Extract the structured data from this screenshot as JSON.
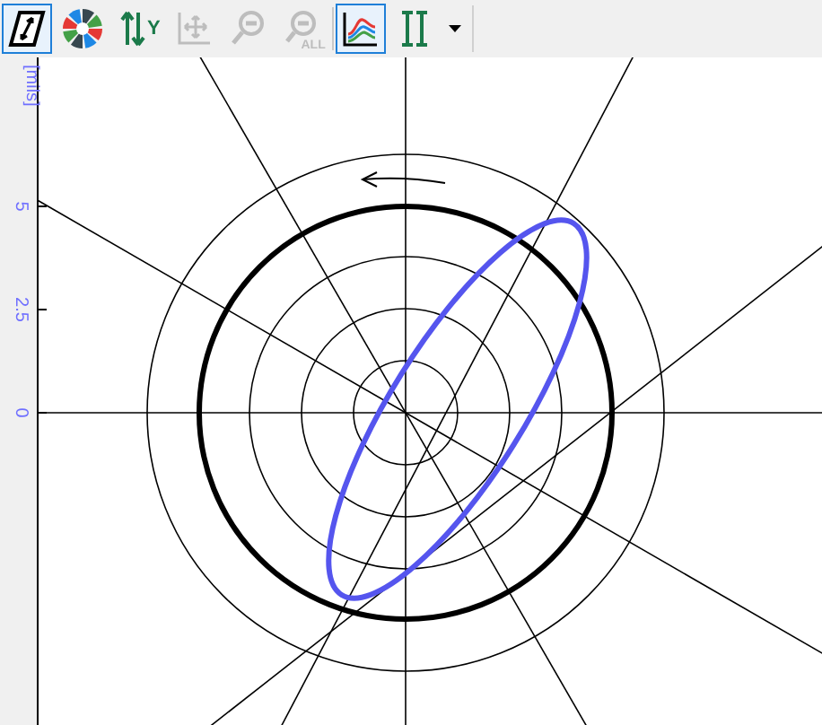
{
  "toolbar": {
    "buttons": [
      {
        "kind": "diagonal",
        "selected": true,
        "disabled": false
      },
      {
        "kind": "colorwheel",
        "selected": false,
        "disabled": false
      },
      {
        "kind": "scale",
        "label": "Y",
        "selected": false,
        "disabled": false
      },
      {
        "kind": "reticle",
        "selected": false,
        "disabled": true
      },
      {
        "kind": "zoom",
        "selected": false,
        "disabled": true
      },
      {
        "kind": "zoomall",
        "label": "ALL",
        "selected": false,
        "disabled": true
      },
      {
        "kind": "chart",
        "selected": true,
        "disabled": false
      },
      {
        "kind": "cursor",
        "selected": false,
        "disabled": false
      },
      {
        "kind": "dropdown",
        "selected": false,
        "disabled": false
      }
    ]
  },
  "plot": {
    "y_unit": "[mils]",
    "y_labels": [
      "5",
      "2.5",
      "0"
    ]
  }
}
